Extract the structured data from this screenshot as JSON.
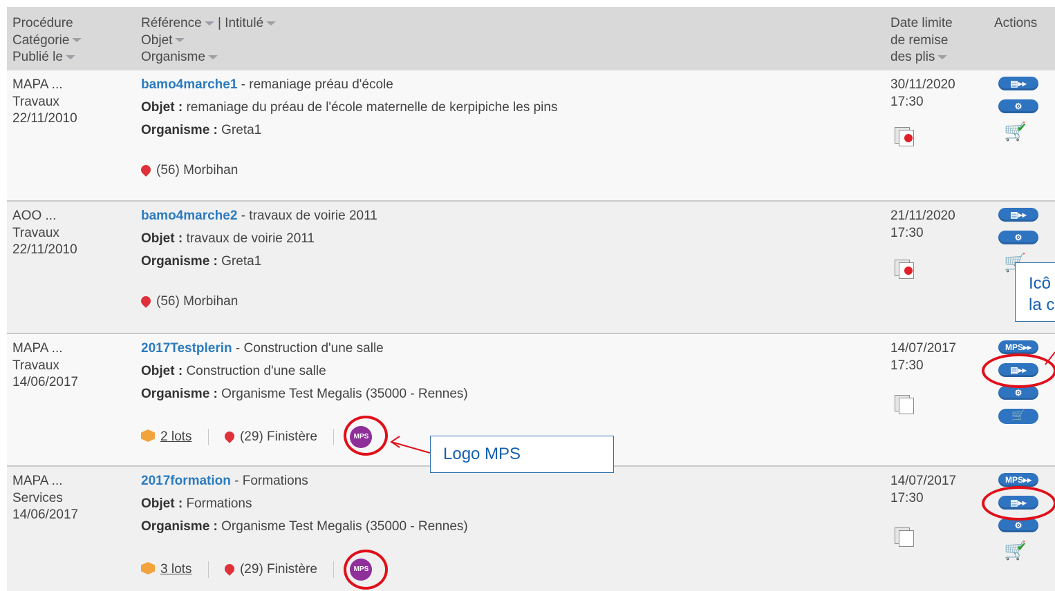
{
  "header": {
    "col1": [
      "Procédure",
      "Catégorie",
      "Publié le"
    ],
    "col2": [
      "Référence",
      "| Intitulé",
      "Objet",
      "Organisme"
    ],
    "col3": [
      "Date limite",
      "de remise",
      "des plis"
    ],
    "col4": "Actions"
  },
  "rows": [
    {
      "procedure": "MAPA ...",
      "categorie": "Travaux",
      "publie": "22/11/2010",
      "reference": "bamo4marche1",
      "intitule": " - remaniage préau d'école",
      "objet_label": "Objet :",
      "objet": " remaniage du préau de l'école maternelle de kerpipiche les pins",
      "organisme_label": "Organisme :",
      "organisme": " Greta1",
      "location": "(56) Morbihan",
      "date": "30/11/2020",
      "heure": "17:30"
    },
    {
      "procedure": "AOO ...",
      "categorie": "Travaux",
      "publie": "22/11/2010",
      "reference": "bamo4marche2",
      "intitule": " - travaux de voirie 2011",
      "objet_label": "Objet :",
      "objet": " travaux de voirie 2011",
      "organisme_label": "Organisme :",
      "organisme": " Greta1",
      "location": "(56) Morbihan",
      "date": "21/11/2020",
      "heure": "17:30"
    },
    {
      "procedure": "MAPA ...",
      "categorie": "Travaux",
      "publie": "14/06/2017",
      "reference": "2017Testplerin",
      "intitule": " - Construction d'une salle",
      "objet_label": "Objet :",
      "objet": " Construction d'une salle",
      "organisme_label": "Organisme :",
      "organisme": " Organisme Test Megalis (35000 - Rennes)",
      "lots": "2 lots",
      "location": "(29) Finistère",
      "mps": "MPS",
      "date": "14/07/2017",
      "heure": "17:30"
    },
    {
      "procedure": "MAPA ...",
      "categorie": "Services",
      "publie": "14/06/2017",
      "reference": "2017formation",
      "intitule": " - Formations",
      "objet_label": "Objet :",
      "objet": " Formations",
      "organisme_label": "Organisme :",
      "organisme": " Organisme Test Megalis (35000 - Rennes)",
      "lots": "3 lots",
      "location": "(29) Finistère",
      "mps": "MPS",
      "date": "14/07/2017",
      "heure": "17:30"
    }
  ],
  "actions": {
    "detail": "▤▸▸",
    "config": "⚙",
    "mps": "MPS▸▸",
    "cart": "🛒"
  },
  "callouts": {
    "logo_mps": "Logo MPS",
    "icon_line1": "Icô",
    "icon_line2": "la c"
  },
  "colors": {
    "link": "#2b7bbf",
    "pill": "#2f74c0",
    "annotation": "#e0101a",
    "mps": "#8e2f9a"
  }
}
